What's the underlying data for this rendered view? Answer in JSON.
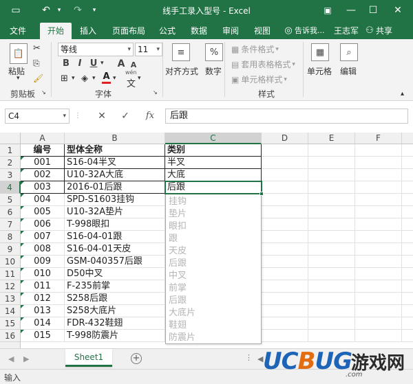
{
  "titlebar": {
    "title": "线手工录入型号 - Excel",
    "save_glyph": "▭",
    "undo_glyph": "↶",
    "redo_glyph": "↷",
    "min_glyph": "—",
    "max_glyph": "☐",
    "close_glyph": "✕",
    "ribbon_opt_glyph": "▣"
  },
  "tabs": [
    "文件",
    "开始",
    "插入",
    "页面布局",
    "公式",
    "数据",
    "审阅",
    "视图"
  ],
  "active_tab": "开始",
  "tell_me": "告诉我...",
  "user": "王志军",
  "share": "共享",
  "ribbon": {
    "paste": "粘贴",
    "clipboard": "剪贴板",
    "font_name": "等线",
    "font_size": "11",
    "font_group": "字体",
    "alignment": "对齐方式",
    "number": "数字",
    "cond_format": "条件格式",
    "table_format": "套用表格格式",
    "cell_style": "单元格样式",
    "styles_group": "样式",
    "cells": "单元格",
    "editing": "编辑",
    "bold": "B",
    "italic": "I",
    "underline": "U",
    "font_a": "A",
    "grow": "A",
    "shrink": "A",
    "wen": "wén",
    "wen_char": "文",
    "percent": "%"
  },
  "formula_bar": {
    "name_box": "C4",
    "content": "后跟",
    "fx": "fx",
    "cancel": "✕",
    "enter": "✓"
  },
  "columns": [
    "A",
    "B",
    "C",
    "D",
    "E",
    "F"
  ],
  "selected_column": "C",
  "rows": [
    {
      "n": "1",
      "a": "编号",
      "b": "型体全称",
      "c": "类别"
    },
    {
      "n": "2",
      "a": "001",
      "b": "S16-04半叉",
      "c": "半叉"
    },
    {
      "n": "3",
      "a": "002",
      "b": "U10-32A大底",
      "c": "大底"
    },
    {
      "n": "4",
      "a": "003",
      "b": "2016-01后跟",
      "c": "后跟"
    },
    {
      "n": "5",
      "a": "004",
      "b": "SPD-S1603挂钩",
      "c": ""
    },
    {
      "n": "6",
      "a": "005",
      "b": "U10-32A垫片",
      "c": ""
    },
    {
      "n": "7",
      "a": "006",
      "b": "T-998眼扣",
      "c": ""
    },
    {
      "n": "8",
      "a": "007",
      "b": "S16-04-01跟",
      "c": ""
    },
    {
      "n": "9",
      "a": "008",
      "b": "S16-04-01天皮",
      "c": ""
    },
    {
      "n": "10",
      "a": "009",
      "b": "GSM-040357后跟",
      "c": ""
    },
    {
      "n": "11",
      "a": "010",
      "b": "D50中叉",
      "c": ""
    },
    {
      "n": "12",
      "a": "011",
      "b": "F-235前掌",
      "c": ""
    },
    {
      "n": "13",
      "a": "012",
      "b": "S258后跟",
      "c": ""
    },
    {
      "n": "14",
      "a": "013",
      "b": "S258大底片",
      "c": ""
    },
    {
      "n": "15",
      "a": "014",
      "b": "FDR-432鞋翅",
      "c": ""
    },
    {
      "n": "16",
      "a": "015",
      "b": "T-998防震片",
      "c": ""
    }
  ],
  "autocomplete": [
    "挂钩",
    "垫片",
    "眼扣",
    "跟",
    "天皮",
    "后跟",
    "中叉",
    "前掌",
    "后跟",
    "大底片",
    "鞋翅",
    "防震片"
  ],
  "sheet_tab": "Sheet1",
  "add_sheet": "+",
  "status": "输入",
  "watermark": {
    "text_a": "UC",
    "text_o": "B",
    "text_b": "UG",
    "cn": "游戏网",
    "domain": ".com"
  },
  "colors": {
    "accent": "#217346",
    "hint_text": "#b4b4b4"
  }
}
